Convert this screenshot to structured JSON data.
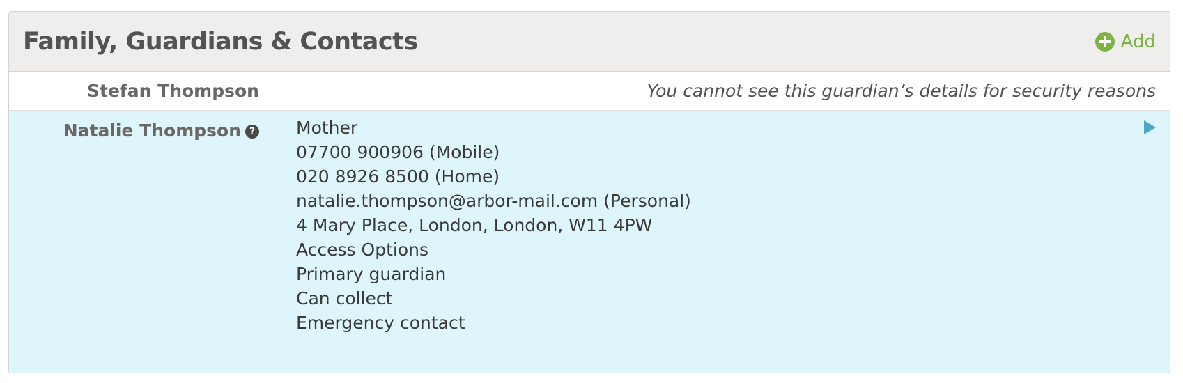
{
  "panel": {
    "title": "Family, Guardians & Contacts",
    "add_label": "Add"
  },
  "guardians": [
    {
      "name": "Stefan Thompson",
      "message": "You cannot see this guardian’s details for security reasons"
    },
    {
      "name": "Natalie Thompson",
      "details": [
        "Mother",
        "07700 900906 (Mobile)",
        "020 8926 8500 (Home)",
        "natalie.thompson@arbor-mail.com (Personal)",
        "4 Mary Place, London, London, W11 4PW",
        "Access Options",
        "Primary guardian",
        "Can collect",
        "Emergency contact"
      ]
    }
  ],
  "icons": {
    "add": "plus-circle-icon",
    "help": "question-circle-icon",
    "expand": "triangle-right-icon"
  },
  "colors": {
    "header_bg": "#efeeed",
    "accent_green": "#7cb342",
    "row_highlight": "#def6fb",
    "expand_blue": "#4aa8c8"
  }
}
